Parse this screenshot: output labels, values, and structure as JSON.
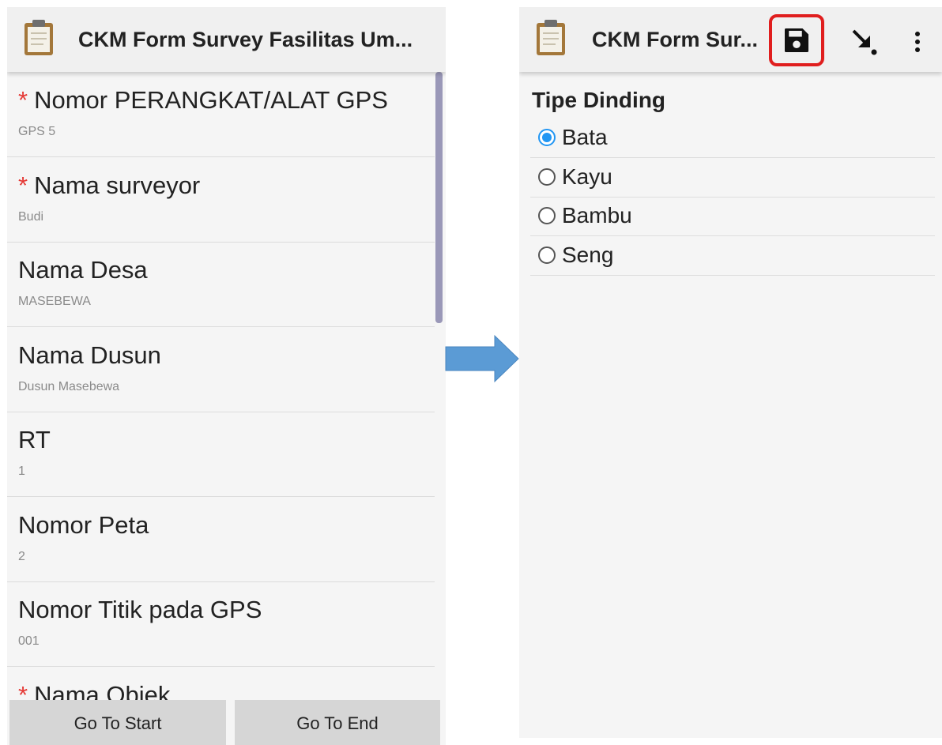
{
  "left_screen": {
    "title": "CKM Form Survey Fasilitas Um...",
    "rows": [
      {
        "required": true,
        "label": "Nomor PERANGKAT/ALAT GPS",
        "value": "GPS 5"
      },
      {
        "required": true,
        "label": "Nama surveyor",
        "value": "Budi"
      },
      {
        "required": false,
        "label": "Nama Desa",
        "value": "MASEBEWA"
      },
      {
        "required": false,
        "label": "Nama Dusun",
        "value": "Dusun Masebewa"
      },
      {
        "required": false,
        "label": "RT",
        "value": "1"
      },
      {
        "required": false,
        "label": "Nomor Peta",
        "value": "2"
      },
      {
        "required": false,
        "label": "Nomor Titik pada GPS",
        "value": "001"
      },
      {
        "required": true,
        "label": "Nama Objek",
        "value": ""
      }
    ],
    "required_marker": "*",
    "go_to_start_label": "Go To Start",
    "go_to_end_label": "Go To End"
  },
  "right_screen": {
    "title": "CKM Form Sur...",
    "question": "Tipe Dinding",
    "options": [
      {
        "label": "Bata",
        "checked": true
      },
      {
        "label": "Kayu",
        "checked": false
      },
      {
        "label": "Bambu",
        "checked": false
      },
      {
        "label": "Seng",
        "checked": false
      }
    ],
    "icons": {
      "save": "save-icon",
      "go_to": "go-to-arrow-icon",
      "overflow": "more-vert-icon"
    }
  },
  "colors": {
    "accent": "#2196f3",
    "required": "#e53935",
    "highlight": "#e01e1e",
    "arrow": "#5b9bd5"
  }
}
